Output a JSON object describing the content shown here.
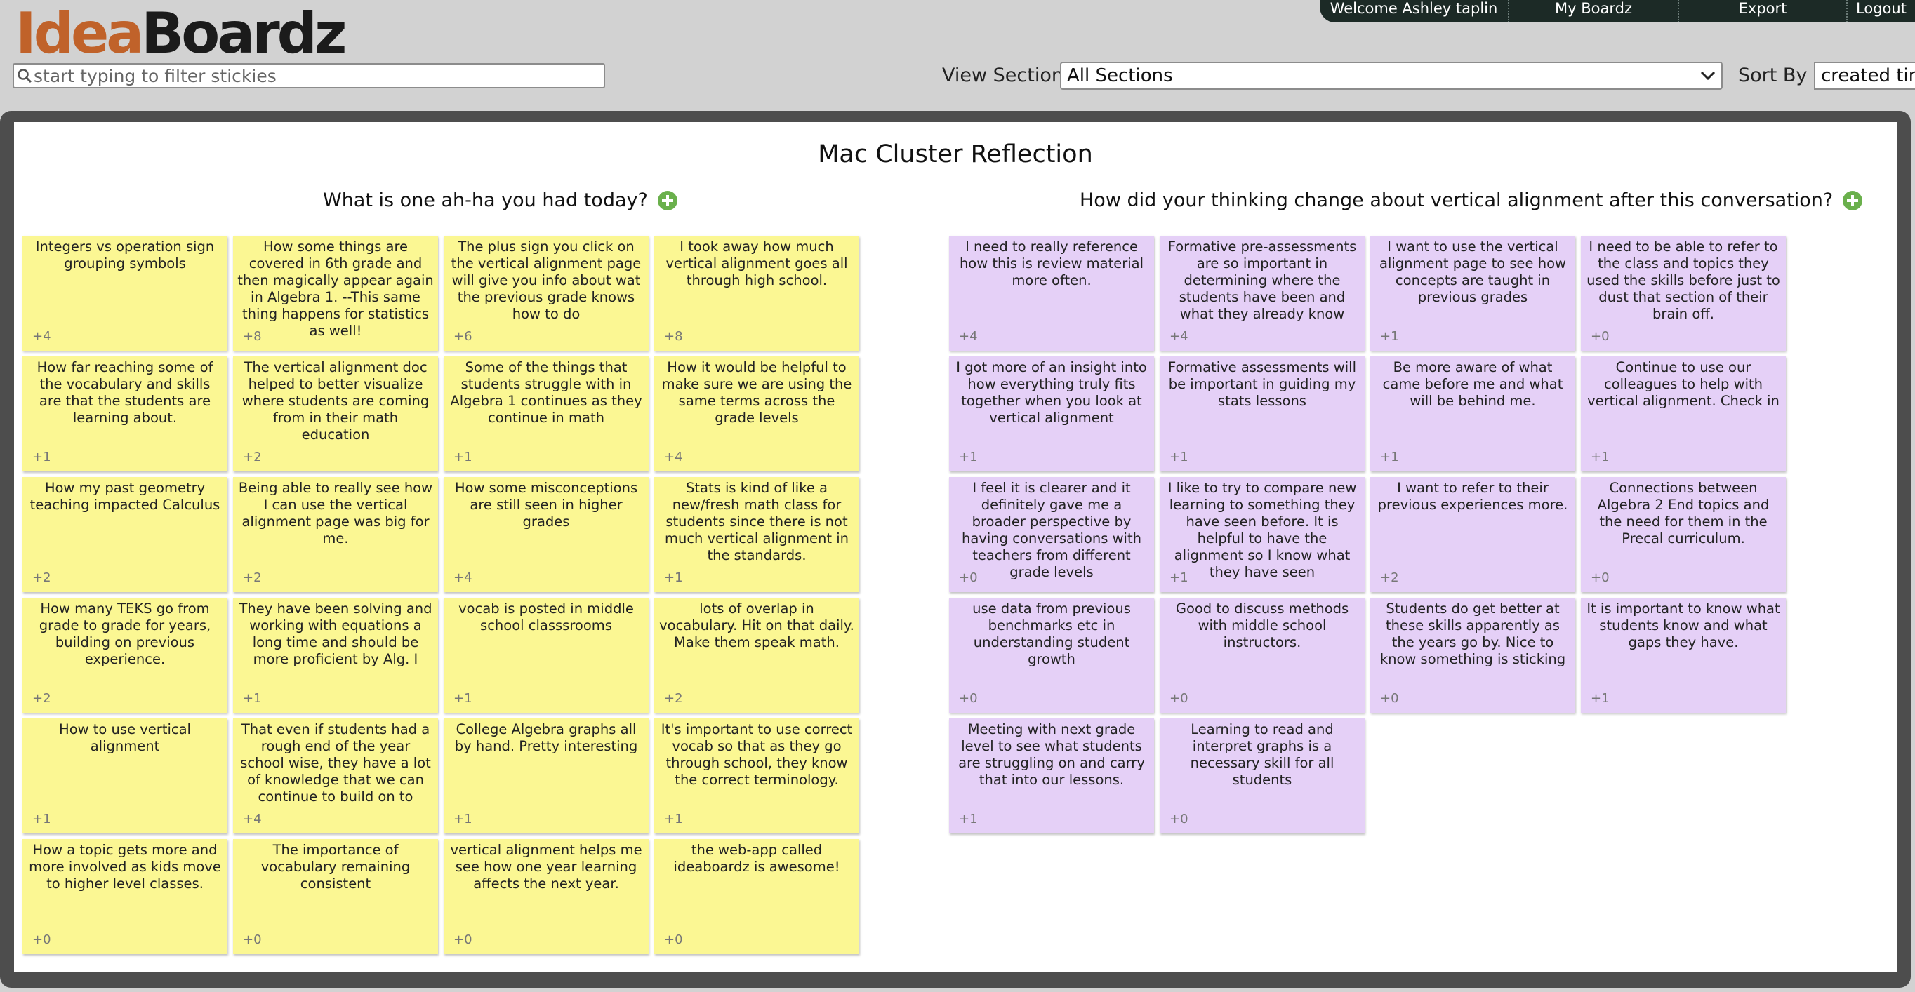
{
  "header": {
    "logo_part1": "Idea",
    "logo_part2": "Boardz",
    "nav": [
      "Welcome Ashley taplin",
      "My Boardz",
      "Export",
      "Logout"
    ],
    "search_placeholder": "start typing to filter stickies",
    "view_section_label": "View Section",
    "view_section_value": "All Sections",
    "sort_by_label": "Sort By",
    "sort_by_value": "created time"
  },
  "board": {
    "title": "Mac Cluster Reflection",
    "sections": [
      {
        "heading": "What is one ah-ha you had today?",
        "color": "#fbf793",
        "stickies": [
          {
            "text": "Integers vs operation sign grouping symbols",
            "votes": "+4"
          },
          {
            "text": "How some things are covered in 6th grade and then magically appear again in Algebra 1. --This same thing happens for statistics as well!",
            "votes": "+8"
          },
          {
            "text": "The plus sign you click on the vertical alignment page will give you info about wat the previous grade knows how to do",
            "votes": "+6"
          },
          {
            "text": "I took away how much vertical alignment goes all through high school.",
            "votes": "+8"
          },
          {
            "text": "How far reaching some of the vocabulary and skills are that the students are learning about.",
            "votes": "+1"
          },
          {
            "text": "The vertical alignment doc helped to better visualize where students are coming from in their math education",
            "votes": "+2"
          },
          {
            "text": "Some of the things that students struggle with in Algebra 1 continues as they continue in math",
            "votes": "+1"
          },
          {
            "text": "How it would be helpful to make sure we are using the same terms across the grade levels",
            "votes": "+4"
          },
          {
            "text": "How my past geometry teaching impacted Calculus",
            "votes": "+2"
          },
          {
            "text": "Being able to really see how I can use the vertical alignment page was big for me.",
            "votes": "+2"
          },
          {
            "text": "How some misconceptions are still seen in higher grades",
            "votes": "+4"
          },
          {
            "text": "Stats is kind of like a new/fresh math class for students since there is not much vertical alignment in the standards.",
            "votes": "+1"
          },
          {
            "text": "How many TEKS go from grade to grade for years, building on previous experience.",
            "votes": "+2"
          },
          {
            "text": "They have been solving and working with equations a long time and should be more proficient by Alg. I",
            "votes": "+1"
          },
          {
            "text": "vocab is posted in middle school classsrooms",
            "votes": "+1"
          },
          {
            "text": "lots of overlap in vocabulary. Hit on that daily. Make them speak math.",
            "votes": "+2"
          },
          {
            "text": "How to use vertical alignment",
            "votes": "+1"
          },
          {
            "text": "That even if students had a rough end of the year school wise, they have a lot of knowledge that we can continue to build on to",
            "votes": "+4"
          },
          {
            "text": "College Algebra graphs all by hand. Pretty interesting",
            "votes": "+1"
          },
          {
            "text": "It's important to use correct vocab so that as they go through school, they know the correct terminology.",
            "votes": "+1"
          },
          {
            "text": "How a topic gets more and more involved as kids move to higher level classes.",
            "votes": "+0"
          },
          {
            "text": "The importance of vocabulary remaining consistent",
            "votes": "+0"
          },
          {
            "text": "vertical alignment helps me see how one year learning affects the next year.",
            "votes": "+0"
          },
          {
            "text": "the web-app called ideaboardz is awesome!",
            "votes": "+0"
          }
        ]
      },
      {
        "heading": "How did your thinking change about vertical alignment after this conversation?",
        "color": "#e5d0f7",
        "stickies": [
          {
            "text": "I need to really reference how this is review material more often.",
            "votes": "+4"
          },
          {
            "text": "Formative pre-assessments are so important in determining where the students have been and what they already know",
            "votes": "+4"
          },
          {
            "text": "I want to use the vertical alignment page to see how concepts are taught in previous grades",
            "votes": "+1"
          },
          {
            "text": "I need to be able to refer to the class and topics they used the skills before just to dust that section of their brain off.",
            "votes": "+0"
          },
          {
            "text": "I got more of an insight into how everything truly fits together when you look at vertical alignment",
            "votes": "+1"
          },
          {
            "text": "Formative assessments will be important in guiding my stats lessons",
            "votes": "+1"
          },
          {
            "text": "Be more aware of what came before me and what will be behind me.",
            "votes": "+1"
          },
          {
            "text": "Continue to use our colleagues to help with vertical alignment. Check in",
            "votes": "+1"
          },
          {
            "text": "I feel it is clearer and it definitely gave me a broader perspective by having conversations with teachers from different grade levels",
            "votes": "+0"
          },
          {
            "text": "I like to try to compare new learning to something they have seen before. It is helpful to have the alignment so I know what they have seen",
            "votes": "+1"
          },
          {
            "text": "I want to refer to their previous experiences more.",
            "votes": "+2"
          },
          {
            "text": "Connections between Algebra 2 End topics and the need for them in the Precal curriculum.",
            "votes": "+0"
          },
          {
            "text": "use data from previous benchmarks etc in understanding student growth",
            "votes": "+0"
          },
          {
            "text": "Good to discuss methods with middle school instructors.",
            "votes": "+0"
          },
          {
            "text": "Students do get better at these skills apparently as the years go by. Nice to know something is sticking",
            "votes": "+0"
          },
          {
            "text": "It is important to know what students know and what gaps they have.",
            "votes": "+1"
          },
          {
            "text": "Meeting with next grade level to see what students are struggling on and carry that into our lessons.",
            "votes": "+1"
          },
          {
            "text": "Learning to read and interpret graphs is a necessary skill for all students",
            "votes": "+0"
          }
        ]
      }
    ]
  }
}
